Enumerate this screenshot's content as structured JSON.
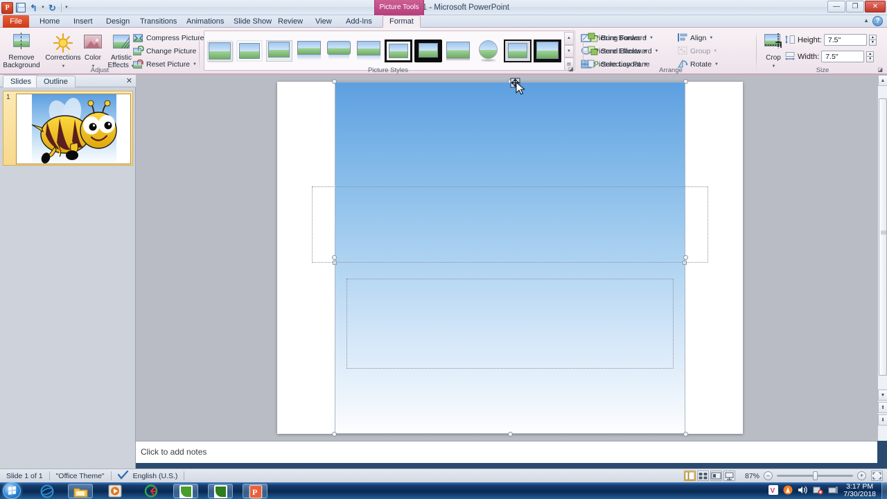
{
  "window": {
    "title": "Presentation1  -  Microsoft PowerPoint",
    "contextual_tab_group": "Picture Tools",
    "minimize": "—",
    "restore": "❐",
    "close": "✕",
    "help": "?",
    "app_icon": "powerpoint-icon"
  },
  "quick_access": {
    "save": "save-icon",
    "undo": "undo-icon",
    "redo": "redo-icon",
    "customize": "customize-icon"
  },
  "tabs": [
    {
      "label": "File",
      "type": "file"
    },
    {
      "label": "Home",
      "type": "normal"
    },
    {
      "label": "Insert",
      "type": "normal"
    },
    {
      "label": "Design",
      "type": "normal"
    },
    {
      "label": "Transitions",
      "type": "normal"
    },
    {
      "label": "Animations",
      "type": "normal"
    },
    {
      "label": "Slide Show",
      "type": "normal"
    },
    {
      "label": "Review",
      "type": "normal"
    },
    {
      "label": "View",
      "type": "normal"
    },
    {
      "label": "Add-Ins",
      "type": "normal"
    },
    {
      "label": "Format",
      "type": "active"
    }
  ],
  "ribbon": {
    "adjust": {
      "label": "Adjust",
      "remove_background": "Remove\nBackground",
      "remove_background_line1": "Remove",
      "remove_background_line2": "Background",
      "corrections": "Corrections",
      "color": "Color",
      "artistic_effects_line1": "Artistic",
      "artistic_effects_line2": "Effects",
      "compress_pictures": "Compress Pictures",
      "change_picture": "Change Picture",
      "reset_picture": "Reset Picture"
    },
    "picture_styles": {
      "label": "Picture Styles",
      "thumb_count": 12,
      "picture_border": "Picture Border",
      "picture_effects": "Picture Effects",
      "picture_layout": "Picture Layout"
    },
    "arrange": {
      "label": "Arrange",
      "bring_forward": "Bring Forward",
      "send_backward": "Send Backward",
      "selection_pane": "Selection Pane",
      "align": "Align",
      "group": "Group",
      "rotate": "Rotate"
    },
    "size": {
      "label": "Size",
      "crop": "Crop",
      "height_label": "Height:",
      "height_value": "7.5\"",
      "width_label": "Width:",
      "width_value": "7.5\""
    }
  },
  "slides_pane": {
    "tab_slides": "Slides",
    "tab_outline": "Outline",
    "close": "✕",
    "slide_number": "1"
  },
  "notes": {
    "placeholder": "Click to add notes"
  },
  "status_bar": {
    "slide_count": "Slide 1 of 1",
    "theme": "\"Office Theme\"",
    "language": "English (U.S.)",
    "spellcheck_icon": "spellcheck-icon",
    "zoom_level": "87%",
    "zoom_out": "–",
    "zoom_in": "+",
    "fit_slide_icon": "fit-to-window-icon",
    "views": [
      "normal-view",
      "slide-sorter-view",
      "reading-view",
      "slide-show-view"
    ]
  },
  "taskbar": {
    "start": "start-orb",
    "items": [
      {
        "name": "internet-explorer",
        "pinned": true
      },
      {
        "name": "windows-explorer",
        "pinned": false
      },
      {
        "name": "media-player",
        "pinned": true
      },
      {
        "name": "cd-burner",
        "pinned": true
      },
      {
        "name": "camtasia-editor",
        "pinned": false
      },
      {
        "name": "camtasia-recorder",
        "pinned": false
      },
      {
        "name": "powerpoint",
        "pinned": false
      }
    ],
    "tray": [
      "vlc-icon",
      "avast-icon",
      "volume-icon",
      "network-error-icon",
      "media-icon"
    ],
    "clock_time": "3:17 PM",
    "clock_date": "7/30/2018"
  },
  "canvas": {
    "image_subject": "cartoon bumble bee",
    "selection_handles": 8,
    "placeholder_boxes": 2,
    "cursor": "move-cursor"
  },
  "colors": {
    "contextual_accent": "#b63e7c",
    "file_tab": "#cf3a18",
    "sky_top": "#5d9fe0",
    "bee_yellow": "#f5c521",
    "bee_dark": "#5c1f1f",
    "selection_handle": "#8795a8"
  }
}
